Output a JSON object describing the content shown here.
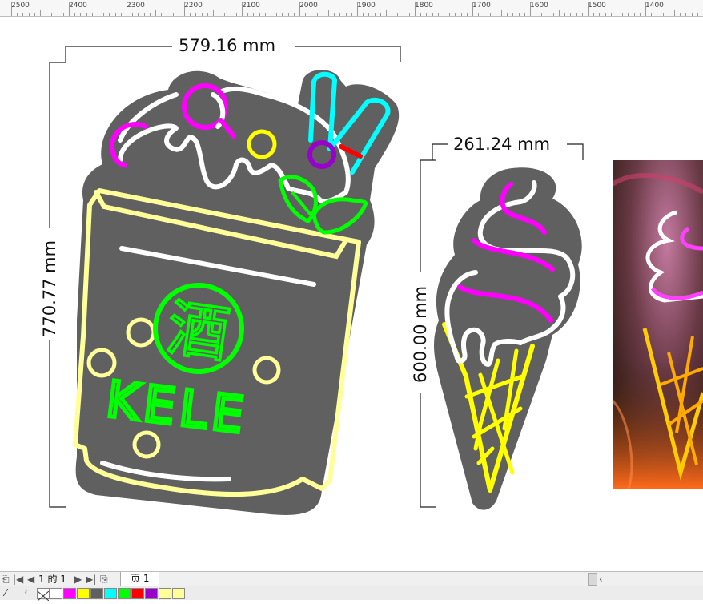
{
  "ruler": {
    "labels": [
      "2500",
      "2400",
      "2300",
      "2200",
      "2100",
      "2000",
      "1900",
      "1800",
      "1700",
      "1600",
      "1500",
      "1400"
    ]
  },
  "drawing": {
    "width_label": "579.16 mm",
    "height_label": "770.77 mm",
    "cone_width_label": "261.24 mm",
    "cone_height_label": "600.00 mm",
    "cup_char": "酒",
    "cup_text": "KELE"
  },
  "pagebar": {
    "page_counter": "1 的 1",
    "page_tab": "页 1"
  },
  "palette": {
    "colors": [
      "#ffffff",
      "#ff00ff",
      "#ffff00",
      "#606060",
      "#00ffff",
      "#00ff00",
      "#ff0000",
      "#9900cc",
      "#ffff99",
      "#ffff99"
    ]
  }
}
